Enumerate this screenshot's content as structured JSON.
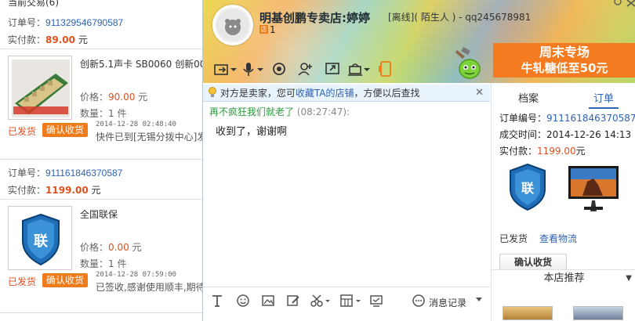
{
  "left_panel": {
    "section_title": "当前交易(6)",
    "orders": [
      {
        "order_label": "订单号：",
        "order_no": "911329546790587",
        "paid_label": "实付款：",
        "paid_amount": "89.00",
        "currency": "元",
        "product_name": "创新5.1声卡 SB0060 创新00",
        "price_label": "价格：",
        "price": "90.00",
        "qty_label": "数量：",
        "qty": "1 件",
        "status": "已发货",
        "confirm_label": "确认收货",
        "log_time": "2014-12-28 02:48:40",
        "log_msg": "快件已到[无锡分拨中心]发"
      },
      {
        "order_label": "订单号：",
        "order_no": "911161846370587",
        "paid_label": "实付款：",
        "paid_amount": "1199.00",
        "currency": "元",
        "product_name": "全国联保",
        "price_label": "价格：",
        "price": "0.00",
        "qty_label": "数量：",
        "qty": "1 件",
        "status": "已发货",
        "confirm_label": "确认收货",
        "log_time": "2014-12-28 07:59:00",
        "log_msg": "已签收,感谢使用顺丰,期待"
      }
    ]
  },
  "chat_header": {
    "shop_name": "明基创鹏专卖店:婷婷",
    "user_status": "[离线]( 陌生人 ) - qq245678981",
    "shop_level": "1",
    "promo_line1": "周末专场",
    "promo_line2": "牛轧糖低至50元"
  },
  "notice": {
    "prefix": "对方是卖家，您可",
    "link": "收藏TA的店铺",
    "suffix": "，方便以后查找",
    "close": "✕"
  },
  "messages": [
    {
      "sender": "再不疯狂我们就老了",
      "time": "(08:27:47):",
      "text": "收到了，谢谢啊"
    }
  ],
  "input_toolbar": {
    "history_label": "消息记录"
  },
  "right_panel": {
    "tab_profile": "档案",
    "tab_order": "订单",
    "order_no_label": "订单编号：",
    "order_no": "911161846370587",
    "deal_time_label": "成交时间：",
    "deal_time": "2014-12-26 14:13",
    "paid_label": "实付款：",
    "paid_amount": "1199.00",
    "currency": "元",
    "status": "已发货",
    "logistics_link": "查看物流",
    "confirm_label": "确认收货",
    "recommend_label": "本店推荐",
    "shield_text": "联"
  },
  "colors": {
    "accent_blue": "#2d63b6",
    "price_orange": "#e0501e",
    "button_orange": "#f07b1a",
    "promo_orange": "#f47b1f"
  }
}
